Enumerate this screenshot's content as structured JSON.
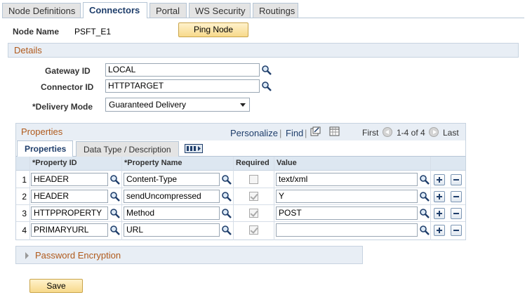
{
  "tabs": [
    {
      "label": "Node Definitions",
      "active": false
    },
    {
      "label": "Connectors",
      "active": true
    },
    {
      "label": "Portal",
      "active": false
    },
    {
      "label": "WS Security",
      "active": false
    },
    {
      "label": "Routings",
      "active": false
    }
  ],
  "node": {
    "label": "Node Name",
    "value": "PSFT_E1",
    "ping_label": "Ping Node"
  },
  "details": {
    "title": "Details"
  },
  "fields": {
    "gateway_label": "Gateway ID",
    "gateway_value": "LOCAL",
    "connector_label": "Connector ID",
    "connector_value": "HTTPTARGET",
    "delivery_label": "*Delivery Mode",
    "delivery_value": "Guaranteed Delivery"
  },
  "grid": {
    "title": "Properties",
    "personalize": "Personalize",
    "find": "Find",
    "first": "First",
    "range": "1-4 of 4",
    "last": "Last",
    "subtabs": [
      "Properties",
      "Data Type / Description"
    ],
    "columns": [
      "*Property ID",
      "*Property Name",
      "Required",
      "Value"
    ],
    "rows": [
      {
        "num": "1",
        "property_id": "HEADER",
        "property_name": "Content-Type",
        "required": false,
        "value": "text/xml"
      },
      {
        "num": "2",
        "property_id": "HEADER",
        "property_name": "sendUncompressed",
        "required": true,
        "value": "Y"
      },
      {
        "num": "3",
        "property_id": "HTTPPROPERTY",
        "property_name": "Method",
        "required": true,
        "value": "POST"
      },
      {
        "num": "4",
        "property_id": "PRIMARYURL",
        "property_name": "URL",
        "required": true,
        "value": ""
      }
    ]
  },
  "password": {
    "label": "Password Encryption"
  },
  "save_label": "Save",
  "colors": {
    "accent": "#b05a1c",
    "link": "#1f3e6b",
    "bar": "#e8eef5",
    "button": "#f7d98b"
  }
}
